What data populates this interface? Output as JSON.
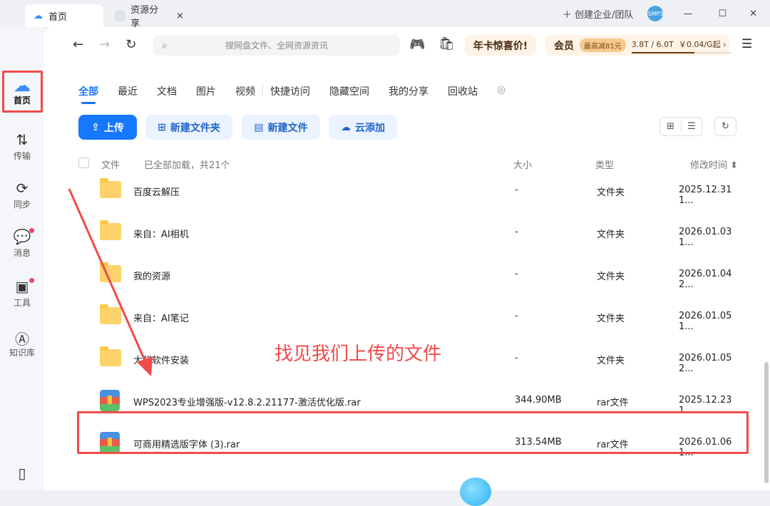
{
  "titlebar": {
    "tabs": [
      {
        "label": "首页",
        "active": true
      },
      {
        "label": "资源分享",
        "close": "×"
      }
    ],
    "create_team": "创建企业/团队",
    "avatar_badge": "SMP3",
    "min": "—",
    "max": "☐",
    "close": "✕"
  },
  "toolbar": {
    "back": "←",
    "forward": "→",
    "refresh": "↻",
    "search_placeholder": "搜网盘文件、全网资源资讯",
    "promo": "年卡惊喜价!",
    "vip_label": "会员",
    "vip_badge": "最高减81元",
    "quota": "3.8T / 6.0T",
    "quota_used": 0.63,
    "price": "￥0.04/G起 ›",
    "menu": "☰"
  },
  "sidebar": {
    "items": [
      {
        "label": "首页",
        "icon": "cloud-logo-icon",
        "active": true
      },
      {
        "label": "传输",
        "icon": "transfer-icon"
      },
      {
        "label": "同步",
        "icon": "sync-icon"
      },
      {
        "label": "消息",
        "icon": "message-icon",
        "dot": true
      },
      {
        "label": "工具",
        "icon": "toolbox-icon",
        "dot": true
      },
      {
        "label": "知识库",
        "icon": "ai-knowledge-icon"
      }
    ]
  },
  "tabs": [
    "全部",
    "最近",
    "文档",
    "图片",
    "视频",
    "快捷访问",
    "隐藏空间",
    "我的分享",
    "回收站"
  ],
  "actions": {
    "upload": "上传",
    "new_folder": "新建文件夹",
    "new_file": "新建文件",
    "cloud_add": "云添加"
  },
  "table": {
    "col_file": "文件",
    "status": "已全部加载，共21个",
    "col_size": "大小",
    "col_type": "类型",
    "col_modified": "修改时间 ⬍",
    "rows": [
      {
        "name": "百度云解压",
        "size": "-",
        "type": "文件夹",
        "modified": "2025.12.31 1...",
        "kind": "folder"
      },
      {
        "name": "来自：AI相机",
        "size": "-",
        "type": "文件夹",
        "modified": "2026.01.03 1...",
        "kind": "folder"
      },
      {
        "name": "我的资源",
        "size": "-",
        "type": "文件夹",
        "modified": "2026.01.04 2...",
        "kind": "folder"
      },
      {
        "name": "来自：AI笔记",
        "size": "-",
        "type": "文件夹",
        "modified": "2026.01.05 1...",
        "kind": "folder"
      },
      {
        "name": "大叔软件安装",
        "size": "-",
        "type": "文件夹",
        "modified": "2026.01.05 2...",
        "kind": "folder"
      },
      {
        "name": "WPS2023专业增强版-v12.8.2.21177-激活优化版.rar",
        "size": "344.90MB",
        "type": "rar文件",
        "modified": "2025.12.23 1...",
        "kind": "rar"
      },
      {
        "name": "可商用精选版字体 (3).rar",
        "size": "313.54MB",
        "type": "rar文件",
        "modified": "2026.01.06 1...",
        "kind": "rar"
      }
    ]
  },
  "annotation": {
    "text": "找见我们上传的文件",
    "color": "#f04a4a"
  },
  "colors": {
    "accent": "#1677ff",
    "annotation": "#f04a4a"
  }
}
